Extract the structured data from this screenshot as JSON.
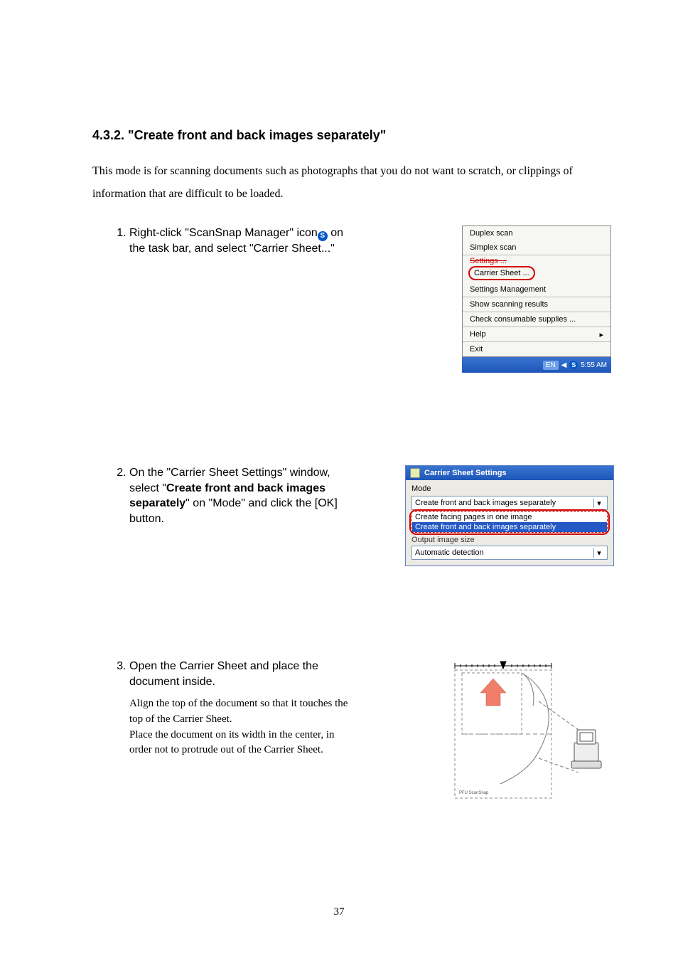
{
  "heading": "4.3.2. \"Create front and back images separately\"",
  "intro": "This mode is for scanning documents such as photographs that you do not want to scratch, or clippings of information that are difficult to be loaded.",
  "steps": {
    "s1": {
      "text_a": "Right-click \"ScanSnap Manager\" icon",
      "text_b": "on the task bar, and select \"Carrier Sheet...\""
    },
    "s2": {
      "text_a": "On the \"Carrier Sheet Settings\" window, select \"",
      "bold": "Create front and back images separately",
      "text_b": "\" on \"Mode\" and click the [OK] button."
    },
    "s3": {
      "text": "Open the Carrier Sheet and place the document inside.",
      "note1": "Align the top of the document so that it touches the top of the Carrier Sheet.",
      "note2": "Place the document on its width in the center, in order not to protrude out of the Carrier Sheet."
    }
  },
  "ctxmenu": {
    "duplex": "Duplex scan",
    "simplex": "Simplex scan",
    "settings": "Settings ...",
    "carrier": "Carrier Sheet ...",
    "settings_mgmt": "Settings Management",
    "show_results": "Show scanning results",
    "check_supplies": "Check consumable supplies ...",
    "help": "Help",
    "exit": "Exit"
  },
  "tray": {
    "lang": "EN",
    "time": "5:55 AM"
  },
  "dialog": {
    "title": "Carrier Sheet Settings",
    "mode_label": "Mode",
    "mode_value": "Create front and back images separately",
    "opt1": "Create facing pages in one image",
    "opt2": "Create front and back images separately",
    "output_label": "Output image size",
    "output_value": "Automatic detection"
  },
  "diagram_label": "PFU   ScanSnap",
  "page_number": "37"
}
